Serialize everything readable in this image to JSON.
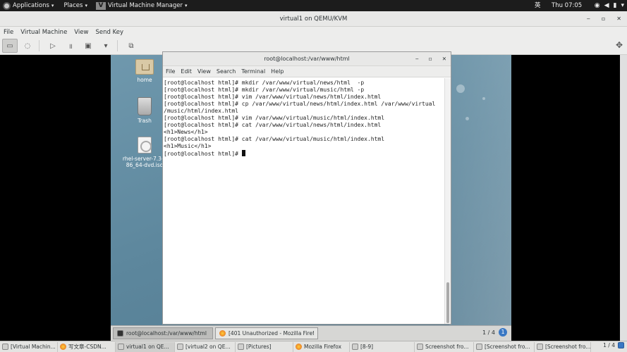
{
  "host_topbar": {
    "applications": "Applications",
    "places": "Places",
    "vm_manager": "Virtual Machine Manager",
    "input_method": "英",
    "clock": "Thu 07:05"
  },
  "vm_window": {
    "title": "virtual1 on QEMU/KVM",
    "menu": [
      "File",
      "Virtual Machine",
      "View",
      "Send Key"
    ]
  },
  "desktop_icons": [
    "home",
    "Trash",
    "rhel-server-7.3-x86_64-dvd.iso"
  ],
  "terminal": {
    "title": "root@localhost:/var/www/html",
    "menu": [
      "File",
      "Edit",
      "View",
      "Search",
      "Terminal",
      "Help"
    ],
    "lines": [
      "[root@localhost html]# mkdir /var/www/virtual/news/html  -p",
      "[root@localhost html]# mkdir /var/www/virtual/music/html -p",
      "[root@localhost html]# vim /var/www/virtual/news/html/index.html",
      "[root@localhost html]# cp /var/www/virtual/news/html/index.html /var/www/virtual",
      "/music/html/index.html",
      "[root@localhost html]# vim /var/www/virtual/music/html/index.html",
      "[root@localhost html]# cat /var/www/virtual/news/html/index.html",
      "<h1>News</h1>",
      "[root@localhost html]# cat /var/www/virtual/music/html/index.html",
      "<h1>Music</h1>",
      "[root@localhost html]# "
    ]
  },
  "guest_panel": {
    "items": [
      "root@localhost:/var/www/html",
      "[401 Unauthorized - Mozilla Firef..."
    ],
    "pager": "1 / 4",
    "badge": "1"
  },
  "host_taskbar": {
    "items": [
      "[Virtual Machin...",
      "写文章-CSDN...",
      "virtual1 on QE...",
      "[virtual2 on QE...",
      "[Pictures]",
      "Mozilla Firefox",
      "[8-9]",
      "Screenshot fro...",
      "[Screenshot fro...",
      "[Screenshot fro..."
    ],
    "pager": "1 / 4"
  }
}
